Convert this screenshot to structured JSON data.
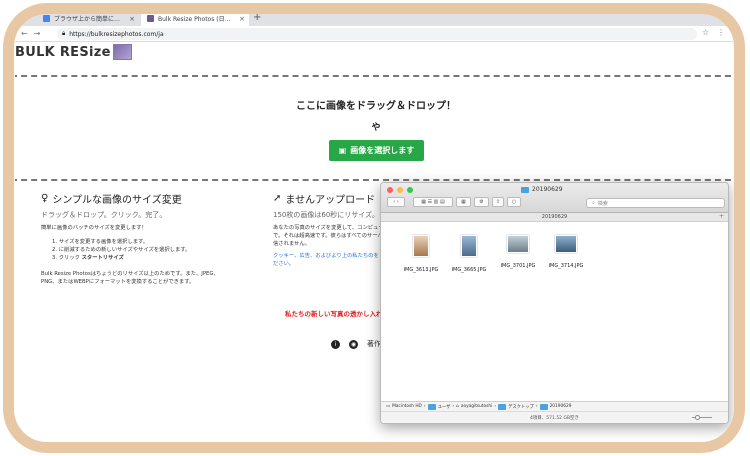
{
  "browser": {
    "tabs": [
      {
        "title": "ブラウザ上から簡単に画像のリサ...",
        "favicon_color": "#4285f4"
      },
      {
        "title": "Bulk Resize Photos (日本語) - 画...",
        "favicon_color": "#6b5b95"
      }
    ],
    "new_tab": "+",
    "url": "https://bulkresizephotos.com/ja",
    "nav": {
      "back": "←",
      "forward": "→",
      "reload": "C"
    },
    "right_icons": {
      "star": "☆",
      "menu": "⋮"
    }
  },
  "site": {
    "logo_text": "BULK RESize",
    "dropzone": {
      "title": "ここに画像をドラッグ＆ドロップ！",
      "or": "や",
      "button": "画像を選択します"
    },
    "col1": {
      "heading": "シンプルな画像のサイズ変更",
      "subheading": "ドラッグ＆ドロップ。クリック。完了。",
      "intro": "簡単に画像のバッチのサイズを変更します！",
      "steps": [
        "1. サイズを変更する画像を選択します。",
        "2. に削減するための新しいサイズやサイズを選択します。"
      ],
      "step3_prefix": "3. クリック ",
      "step3_bold": "スタートリサイズ",
      "footer": "Bulk Resize Photosはちょうどのリサイズ以上のためです。また、JPEG、PNG、またはWEBPにフォーマットを変換することができます。"
    },
    "col2": {
      "heading": "ませんアップロード",
      "subheading": "150枚の画像は60秒にリサイズ。",
      "text": "あなたの写真のサイズを変更して、コンピュータ上で。それは超高速です。彼らはすべてのサーバーに送信されません。",
      "link": "クッキー、広告、およびより上の私たちのを お読みください。"
    },
    "promo": "私たちの新しい写真の透かし入れプ",
    "footer": {
      "copyright_label": "著作権",
      "info_icon": "i",
      "globe_icon": "◉"
    }
  },
  "finder": {
    "title": "20190629",
    "path_label": "20190629",
    "search_placeholder": "検索",
    "files": [
      {
        "name": "IMG_3613.JPG",
        "color": "#c9a27a"
      },
      {
        "name": "IMG_3665.JPG",
        "color": "#6f8fb5"
      },
      {
        "name": "IMG_3701.JPG",
        "color": "#8a9aa6"
      },
      {
        "name": "IMG_3714.JPG",
        "color": "#5d7a99"
      }
    ],
    "breadcrumbs": [
      "Macintosh HD",
      "ユーザ",
      "aoyagitsutoshi",
      "デスクトップ",
      "20190629"
    ],
    "status": "4項目、571.52 GB空き",
    "colors": {
      "close": "#fc605c",
      "minimize": "#fdbc40",
      "zoom": "#34c84a"
    }
  }
}
